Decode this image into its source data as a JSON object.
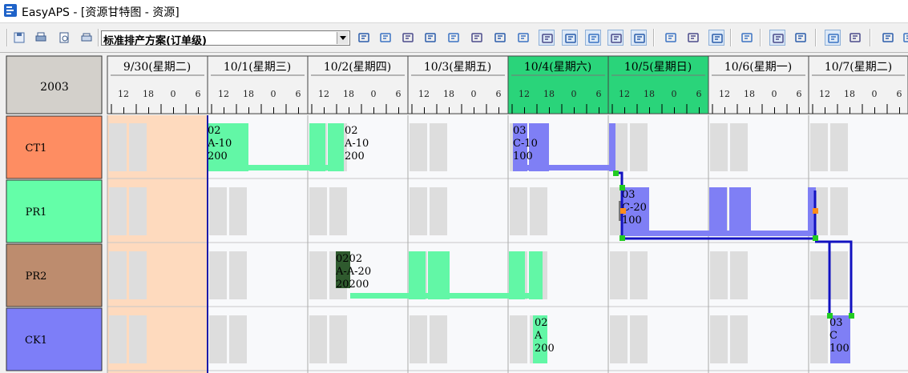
{
  "window": {
    "title": "EasyAPS - [资源甘特图 - 资源]",
    "icon": "easyaps-logo-icon"
  },
  "toolbar": {
    "plan_select": {
      "value": "标准排产方案(订单级)"
    },
    "left_buttons": [
      "save-icon",
      "print-icon",
      "print-preview-icon",
      "print-setup-icon"
    ],
    "right_buttons": [
      "gantt-settings-icon",
      "row-height-icon",
      "copy-icon",
      "indent-icon",
      "filter-icon",
      "align-icon",
      "document-icon",
      "list-icon",
      "clock-refresh-icon",
      "clock-settings-icon",
      "clock-search-icon",
      "clock-copy-icon",
      "clock-record-icon",
      "task-left-icon",
      "task-right-icon",
      "layers-icon",
      "edit-icon",
      "calendar-icon",
      "grid-view-icon",
      "text-align-icon",
      "chart-icon",
      "list-lines-icon",
      "more-icon"
    ]
  },
  "gantt": {
    "year": "2003",
    "days": [
      {
        "label": "9/30(星期二)",
        "holiday": false
      },
      {
        "label": "10/1(星期三)",
        "holiday": false
      },
      {
        "label": "10/2(星期四)",
        "holiday": false
      },
      {
        "label": "10/3(星期五)",
        "holiday": false
      },
      {
        "label": "10/4(星期六)",
        "holiday": true
      },
      {
        "label": "10/5(星期日)",
        "holiday": true
      },
      {
        "label": "10/6(星期一)",
        "holiday": false
      },
      {
        "label": "10/7(星期二)",
        "holiday": false
      }
    ],
    "hour_labels": [
      "12",
      "18",
      "0",
      "6"
    ],
    "resources": [
      {
        "name": "CT1",
        "color": "#fe8d62"
      },
      {
        "name": "PR1",
        "color": "#64fea8"
      },
      {
        "name": "PR2",
        "color": "#bd8c6e"
      },
      {
        "name": "CK1",
        "color": "#7d7ef8"
      }
    ],
    "colors": {
      "order_a": "#62f7a6",
      "order_a_dark": "#2f5a2e",
      "order_c": "#7f7ff5",
      "selection": "#1212c0",
      "current_time": "#1a1aaa",
      "past": "#fedabe",
      "downtime": "#dddddd",
      "holiday_header": "#2ad47a",
      "handle": "#22cc22",
      "handle_alt": "#ff8c1a"
    },
    "task_labels": [
      {
        "id": "ct1-a-start",
        "lines": [
          "02",
          "A-10",
          "200"
        ]
      },
      {
        "id": "ct1-a-end",
        "lines": [
          "02",
          "A-10",
          "200"
        ]
      },
      {
        "id": "ct1-c",
        "lines": [
          "03",
          "C-10",
          "100"
        ]
      },
      {
        "id": "pr1-c",
        "lines": [
          "03",
          "C-20",
          "100"
        ]
      },
      {
        "id": "pr2-a",
        "lines": [
          "0202",
          "A-A-20",
          "20200"
        ]
      },
      {
        "id": "ck1-a",
        "lines": [
          "02",
          "A",
          "200"
        ]
      },
      {
        "id": "ck1-c",
        "lines": [
          "03",
          "C",
          "100"
        ]
      }
    ]
  }
}
